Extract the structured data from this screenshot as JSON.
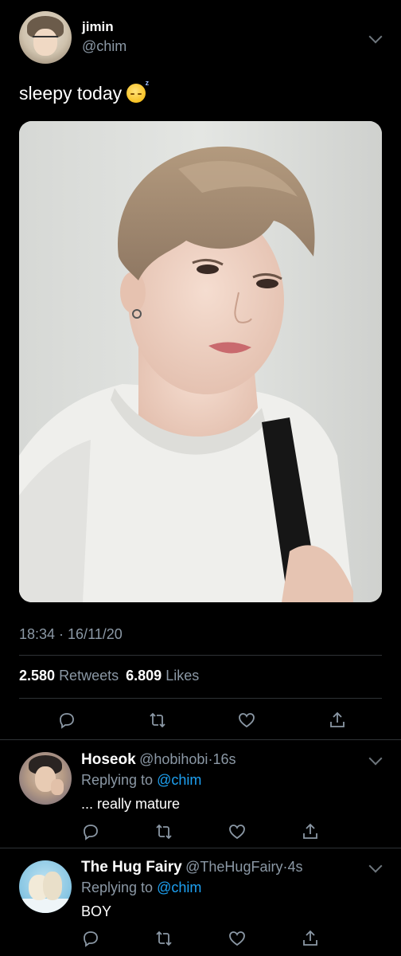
{
  "main_tweet": {
    "author_name": "jimin",
    "author_handle": "@chim",
    "text": "sleepy today",
    "emoji_icon": "sleepy-face-emoji",
    "timestamp": "18:34 · 16/11/20",
    "retweets_count": "2.580",
    "retweets_label": "Retweets",
    "likes_count": "6.809",
    "likes_label": "Likes"
  },
  "replies": [
    {
      "name": "Hoseok",
      "handle": "@hobihobi",
      "sep": "·",
      "time": "16s",
      "replying_prefix": "Replying to",
      "mention": "@chim",
      "text": "... really mature"
    },
    {
      "name": "The Hug Fairy",
      "handle": "@TheHugFairy",
      "sep": "·",
      "time": "4s",
      "replying_prefix": "Replying to",
      "mention": "@chim",
      "text": "BOY"
    }
  ],
  "colors": {
    "background": "#000000",
    "secondary_text": "#8b98a5",
    "link": "#1da1f2",
    "divider": "#2f3336"
  },
  "icons": [
    "reply-icon",
    "retweet-icon",
    "like-icon",
    "share-icon",
    "chevron-down-icon"
  ]
}
